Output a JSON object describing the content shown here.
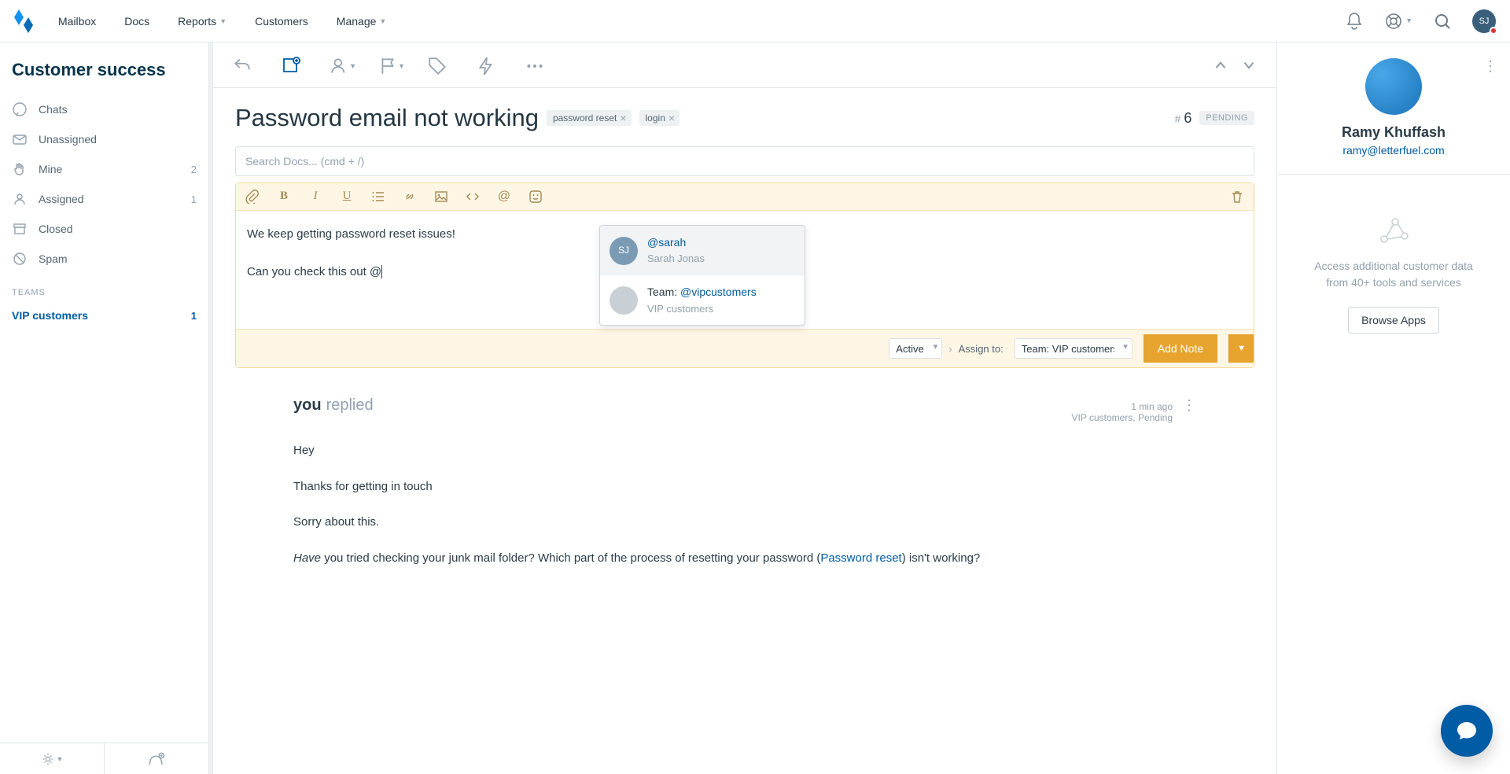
{
  "nav": {
    "links": [
      "Mailbox",
      "Docs",
      "Reports",
      "Customers",
      "Manage"
    ],
    "avatar_initials": "SJ"
  },
  "sidebar": {
    "title": "Customer success",
    "items": [
      {
        "icon": "chat-icon",
        "label": "Chats",
        "count": ""
      },
      {
        "icon": "user-icon",
        "label": "Unassigned",
        "count": ""
      },
      {
        "icon": "hand-icon",
        "label": "Mine",
        "count": "2"
      },
      {
        "icon": "person-icon",
        "label": "Assigned",
        "count": "1"
      },
      {
        "icon": "archive-icon",
        "label": "Closed",
        "count": ""
      },
      {
        "icon": "ban-icon",
        "label": "Spam",
        "count": ""
      }
    ],
    "teams_label": "TEAMS",
    "teams": [
      {
        "label": "VIP customers",
        "count": "1",
        "active": true
      }
    ]
  },
  "ticket": {
    "title": "Password email not working",
    "tags": [
      "password reset",
      "login"
    ],
    "number_prefix": "#",
    "number": "6",
    "status": "PENDING",
    "search_placeholder": "Search Docs... (cmd + /)"
  },
  "compose": {
    "line1": "We keep getting password reset issues!",
    "line2_pre": "Can you check this out ",
    "line2_at": "@",
    "status_select": "Active",
    "assign_label": "Assign to:",
    "assign_select": "Team: VIP customers",
    "add_note": "Add Note"
  },
  "mention": {
    "opt1_handle": "@sarah",
    "opt1_name": "Sarah Jonas",
    "opt1_initials": "SJ",
    "opt2_l1_pre": "Team: ",
    "opt2_l1_handle": "@vipcustomers",
    "opt2_l2": "VIP customers"
  },
  "reply": {
    "you": "you",
    "action": "replied",
    "time": "1 min ago",
    "meta_tags": "VIP customers, Pending",
    "greeting": "Hey",
    "p1": "Thanks for getting in touch",
    "p2": "Sorry about this.",
    "p3_have": "Have",
    "p3_mid": " you tried checking your junk mail folder? Which part of the process of resetting your password (",
    "p3_link": "Password reset",
    "p3_end": ") isn't working?"
  },
  "customer": {
    "name": "Ramy Khuffash",
    "email": "ramy@letterfuel.com",
    "apps_text_l1": "Access additional customer data",
    "apps_text_l2": "from 40+ tools and services",
    "browse_apps": "Browse Apps"
  }
}
